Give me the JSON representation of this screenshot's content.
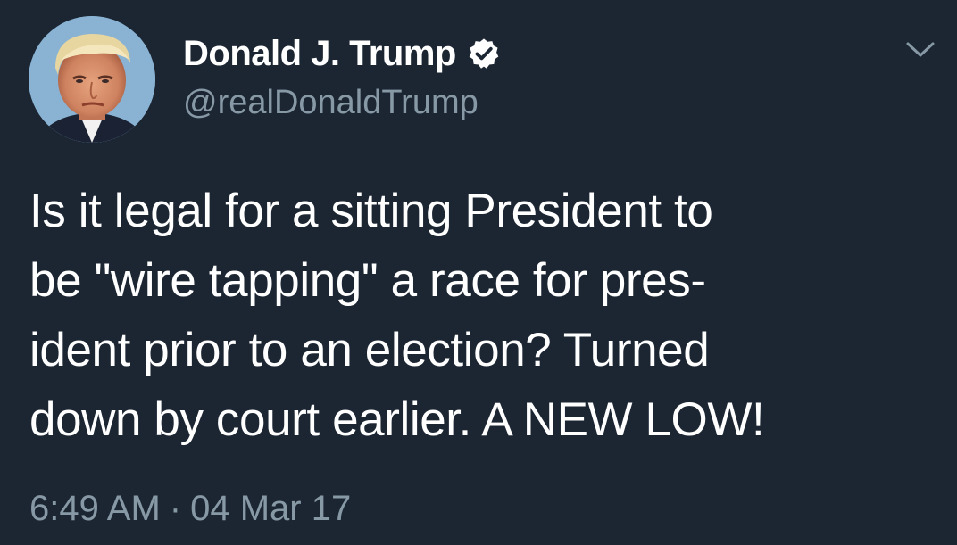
{
  "author": {
    "display_name": "Donald J. Trump",
    "handle": "@realDonaldTrump",
    "verified": true
  },
  "icons": {
    "avatar": "profile-photo",
    "verified": "verified-badge-icon",
    "menu": "chevron-down-icon"
  },
  "tweet": {
    "lines": [
      "Is it legal for a sitting President to",
      "be \"wire tapping\" a race for pres-",
      "ident prior to an election? Turned",
      "down by court earlier. A NEW LOW!"
    ],
    "time": "6:49 AM",
    "separator": "·",
    "date": "04 Mar 17"
  },
  "colors": {
    "background": "#1c2633",
    "primary_text": "#ffffff",
    "secondary_text": "#8899a6"
  }
}
